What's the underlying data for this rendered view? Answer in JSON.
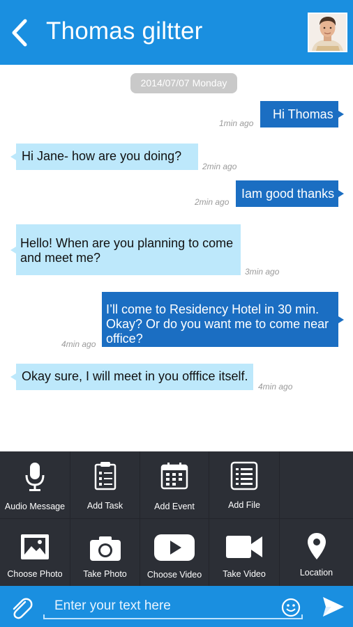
{
  "header": {
    "title": "Thomas giltter"
  },
  "chat": {
    "date": "2014/07/07 Monday",
    "messages": [
      {
        "dir": "out",
        "text": "Hi Thomas",
        "time": "1min ago"
      },
      {
        "dir": "in",
        "text": "Hi Jane- how are you doing?",
        "time": "2min ago"
      },
      {
        "dir": "out",
        "text": "Iam good thanks",
        "time": "2min ago"
      },
      {
        "dir": "in",
        "text": "Hello! When are you planning to come and meet me?",
        "time": "3min ago"
      },
      {
        "dir": "out",
        "text": "I’ll come to Residency Hotel in 30 min. Okay? Or do you want me to come near office?",
        "time": "4min ago"
      },
      {
        "dir": "in",
        "text": "Okay sure, I will meet in you offfice itself.",
        "time": "4min ago"
      }
    ]
  },
  "attach": {
    "items": [
      {
        "label": "Audio Message",
        "icon": "microphone-icon"
      },
      {
        "label": "Add Task",
        "icon": "clipboard-icon"
      },
      {
        "label": "Add Event",
        "icon": "calendar-icon"
      },
      {
        "label": "Add File",
        "icon": "document-list-icon"
      },
      {
        "label": "Choose Photo",
        "icon": "picture-icon"
      },
      {
        "label": "Take Photo",
        "icon": "camera-icon"
      },
      {
        "label": "Choose Video",
        "icon": "play-icon"
      },
      {
        "label": "Take Video",
        "icon": "video-camera-icon"
      },
      {
        "label": "Location",
        "icon": "location-pin-icon"
      }
    ]
  },
  "composer": {
    "placeholder": "Enter your text here"
  },
  "colors": {
    "header": "#1a8fe0",
    "bubble_out": "#1b6ec2",
    "bubble_in": "#bde8fb",
    "panel": "#2c2f36"
  }
}
